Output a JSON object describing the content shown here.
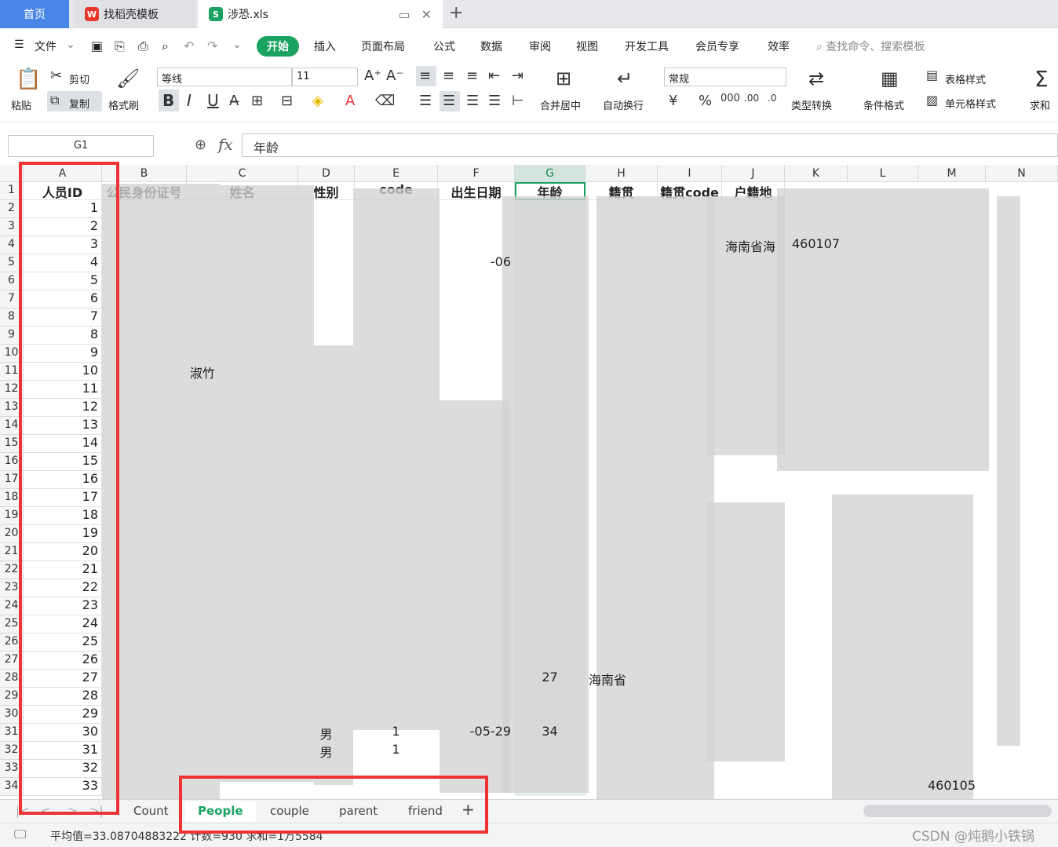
{
  "tabs": {
    "home": "首页",
    "template": "找稻壳模板",
    "file": "涉恐.xls",
    "file_logo": "S"
  },
  "menu": {
    "file": "文件",
    "start": "开始",
    "insert": "插入",
    "page_layout": "页面布局",
    "formula": "公式",
    "data": "数据",
    "review": "审阅",
    "view": "视图",
    "dev": "开发工具",
    "member": "会员专享",
    "efficiency": "效率",
    "search": "查找命令、搜索模板"
  },
  "ribbon": {
    "paste": "粘贴",
    "cut": "剪切",
    "copy": "复制",
    "format_painter": "格式刷",
    "font_name": "等线",
    "font_size": "11",
    "bold": "B",
    "italic": "I",
    "underline": "U",
    "merge": "合并居中",
    "wrap": "自动换行",
    "number_format": "常规",
    "convert": "类型转换",
    "cond_format": "条件格式",
    "table_style": "表格样式",
    "cell_style": "单元格样式",
    "sum": "求和"
  },
  "formula_bar": {
    "name_box": "G1",
    "fx": "fx",
    "value": "年龄"
  },
  "columns": [
    "A",
    "B",
    "C",
    "D",
    "E",
    "F",
    "G",
    "H",
    "I",
    "J",
    "K",
    "L",
    "M",
    "N"
  ],
  "headers": {
    "A": "人员ID",
    "B": "公民身份证号",
    "C": "姓名",
    "D": "性别",
    "E": "code",
    "F": "出生日期",
    "G": "年龄",
    "H": "籍贯",
    "I": "籍贯code",
    "J": "户籍地"
  },
  "person_ids": [
    "1",
    "2",
    "3",
    "4",
    "5",
    "6",
    "7",
    "8",
    "9",
    "10",
    "11",
    "12",
    "13",
    "14",
    "15",
    "16",
    "17",
    "18",
    "19",
    "20",
    "21",
    "22",
    "23",
    "24",
    "25",
    "26",
    "27",
    "28",
    "29",
    "30",
    "31",
    "32",
    "33"
  ],
  "visible_fragments": {
    "r10_name": "淑竹",
    "r30_gender": "男",
    "r30_code": "1",
    "r30_date": "-05-29",
    "r30_age": "34",
    "r31_gender": "男",
    "r31_code": "1",
    "r27_age": "27",
    "r27_place": "海南省",
    "r3_place": "海南省海",
    "r3_code": "460107",
    "r33_code": "460105",
    "r3_date": "-06"
  },
  "sheets": [
    "Count",
    "People",
    "couple",
    "parent",
    "friend"
  ],
  "active_sheet": "People",
  "status": "平均值=33.08704883222 计数=930 求和=1万5584",
  "watermark": "CSDN @炖鹅小铁锅"
}
